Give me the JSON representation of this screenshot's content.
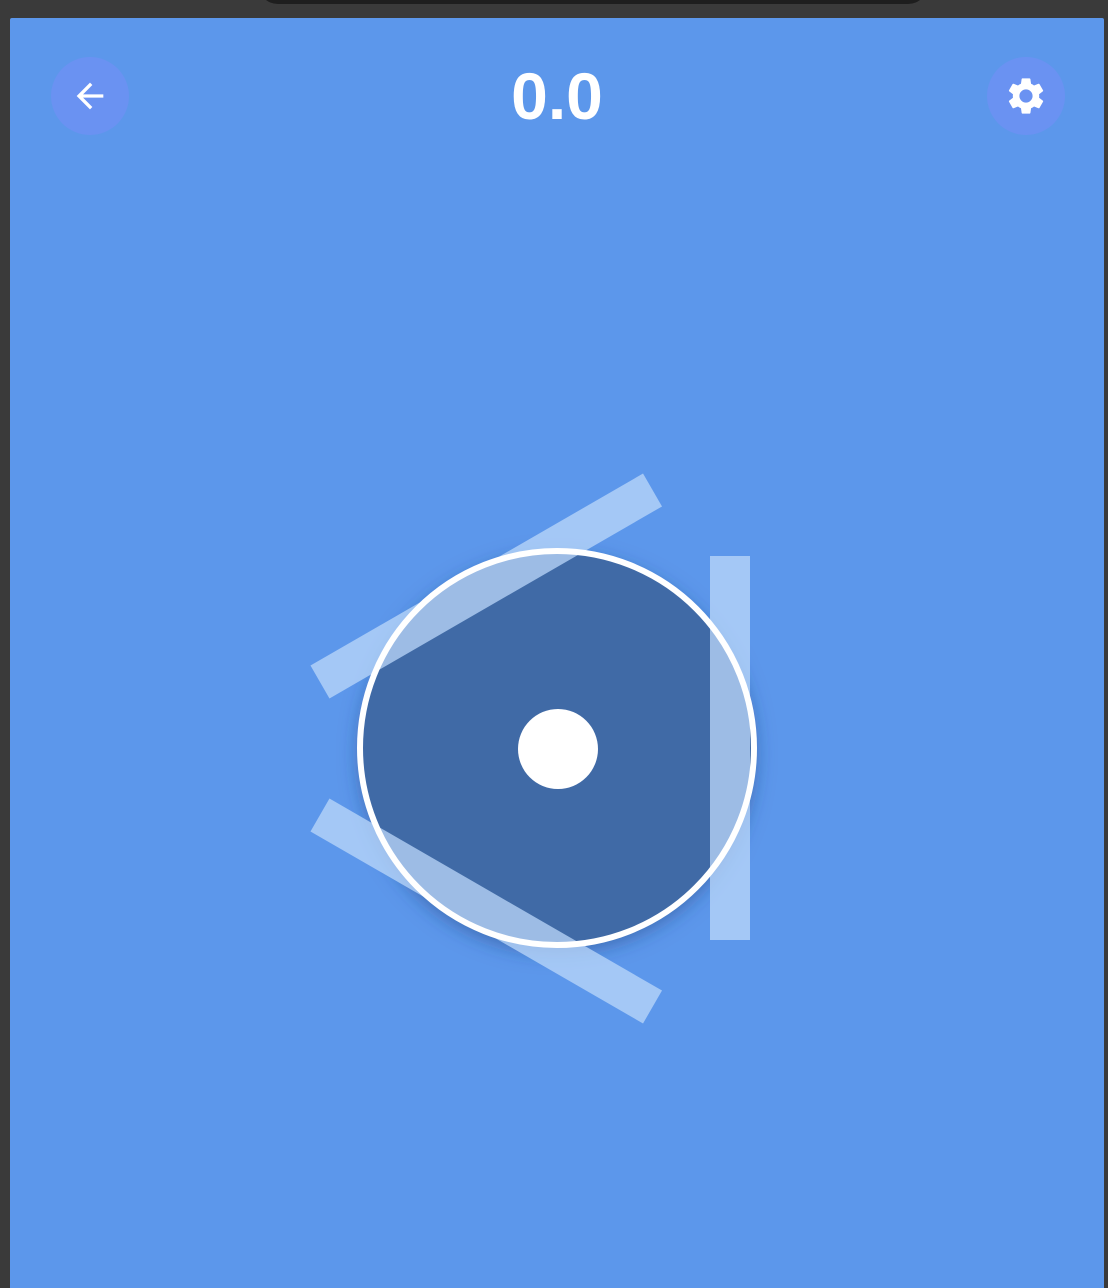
{
  "header": {
    "score": "0.0",
    "back_icon": "arrow-left-icon",
    "settings_icon": "gear-icon"
  },
  "colors": {
    "background": "#5c97eb",
    "button_bg": "#6a92f2",
    "paddle": "#a8cbf5",
    "ring_fill": "#3f6ba6",
    "ring_stroke": "#ffffff",
    "ball": "#ffffff"
  },
  "game": {
    "paddle_count": 3
  }
}
